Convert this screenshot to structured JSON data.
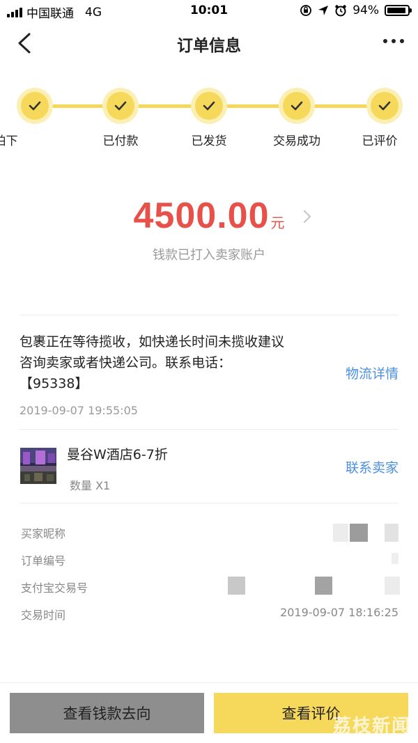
{
  "status_bar": {
    "carrier": "中国联通",
    "network": "4G",
    "time": "10:01",
    "battery": "94%",
    "battery_level": 0.94
  },
  "nav": {
    "title": "订单信息"
  },
  "steps": [
    {
      "label": "已拍下"
    },
    {
      "label": "已付款"
    },
    {
      "label": "已发货"
    },
    {
      "label": "交易成功"
    },
    {
      "label": "已评价"
    }
  ],
  "amount": {
    "value": "4500.00",
    "unit": "元",
    "status": "钱款已打入卖家账户"
  },
  "logistics": {
    "line1": "包裹正在等待揽收，如快递长时间未揽收建议",
    "line2": "咨询卖家或者快递公司。联系电话：",
    "line3": "【95338】",
    "time": "2019-09-07 19:55:05",
    "link": "物流详情"
  },
  "product": {
    "name": "曼谷W酒店6-7折",
    "quantity": "数量 X1",
    "contact_link": "联系卖家"
  },
  "order_info": {
    "buyer_label": "买家昵称",
    "order_no_label": "订单编号",
    "alipay_no_label": "支付宝交易号",
    "time_label": "交易时间",
    "time_value": "2019-09-07 18:16:25"
  },
  "bottom": {
    "flow_button": "查看钱款去向",
    "review_button": "查看评价",
    "watermark": "荔枝新闻"
  },
  "colors": {
    "accent_yellow": "#f6d85b",
    "amount_red": "#e8514a",
    "link_blue": "#4a90e2",
    "grey_button": "#8e8e8e"
  }
}
